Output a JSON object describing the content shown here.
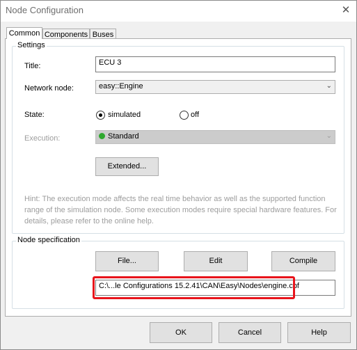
{
  "window": {
    "title": "Node Configuration"
  },
  "tabs": [
    {
      "label": "Common",
      "active": true
    },
    {
      "label": "Components",
      "active": false
    },
    {
      "label": "Buses",
      "active": false
    }
  ],
  "settings": {
    "legend": "Settings",
    "title_label": "Title:",
    "title_value": "ECU 3",
    "network_node_label": "Network node:",
    "network_node_value": "easy::Engine",
    "state_label": "State:",
    "state_options": [
      {
        "label": "simulated",
        "selected": true
      },
      {
        "label": "off",
        "selected": false
      }
    ],
    "execution_label": "Execution:",
    "execution_value": "Standard",
    "extended_button": "Extended...",
    "hint": "Hint: The execution mode affects the real time behavior as well as the supported function range of the simulation node. Some execution modes require special hardware features. For details, please refer to the online help."
  },
  "node_spec": {
    "legend": "Node specification",
    "file_button": "File...",
    "edit_button": "Edit",
    "compile_button": "Compile",
    "path_value": "C:\\...le Configurations 15.2.41\\CAN\\Easy\\Nodes\\engine.cbf"
  },
  "footer": {
    "ok": "OK",
    "cancel": "Cancel",
    "help": "Help"
  },
  "colors": {
    "highlight": "#e8141b",
    "status_ok": "#2ea82e"
  },
  "icons": {
    "close": "close-icon",
    "dropdown": "chevron-down-icon",
    "execution_status": "green-check-circle-icon"
  }
}
